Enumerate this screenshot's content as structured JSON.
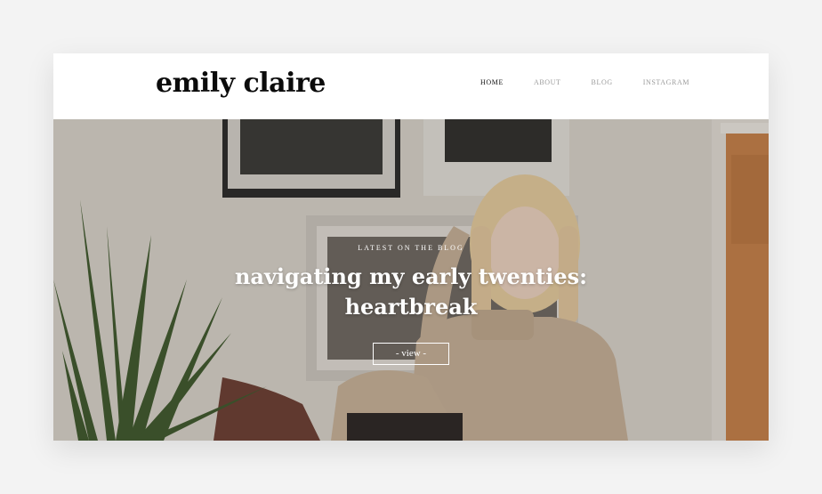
{
  "header": {
    "logo": "emily claire",
    "nav": [
      "HOME",
      "ABOUT",
      "BLOG",
      "INSTAGRAM"
    ],
    "active_nav": "HOME"
  },
  "hero": {
    "kicker": "LATEST ON THE BLOG",
    "title_line1": "navigating my early twenties:",
    "title_line2": "heartbreak",
    "button_label": "- view -"
  },
  "colors": {
    "background": "#f3f3f3",
    "header_bg": "#ffffff",
    "logo": "#0b0b0b",
    "nav_active": "#111111",
    "nav_inactive": "#9a9a9a",
    "wall": "#ddd8d0",
    "door": "#c9824a",
    "sweater": "#c9b39a",
    "hair": "#e8cfa0",
    "plant": "#3f5a2e"
  }
}
